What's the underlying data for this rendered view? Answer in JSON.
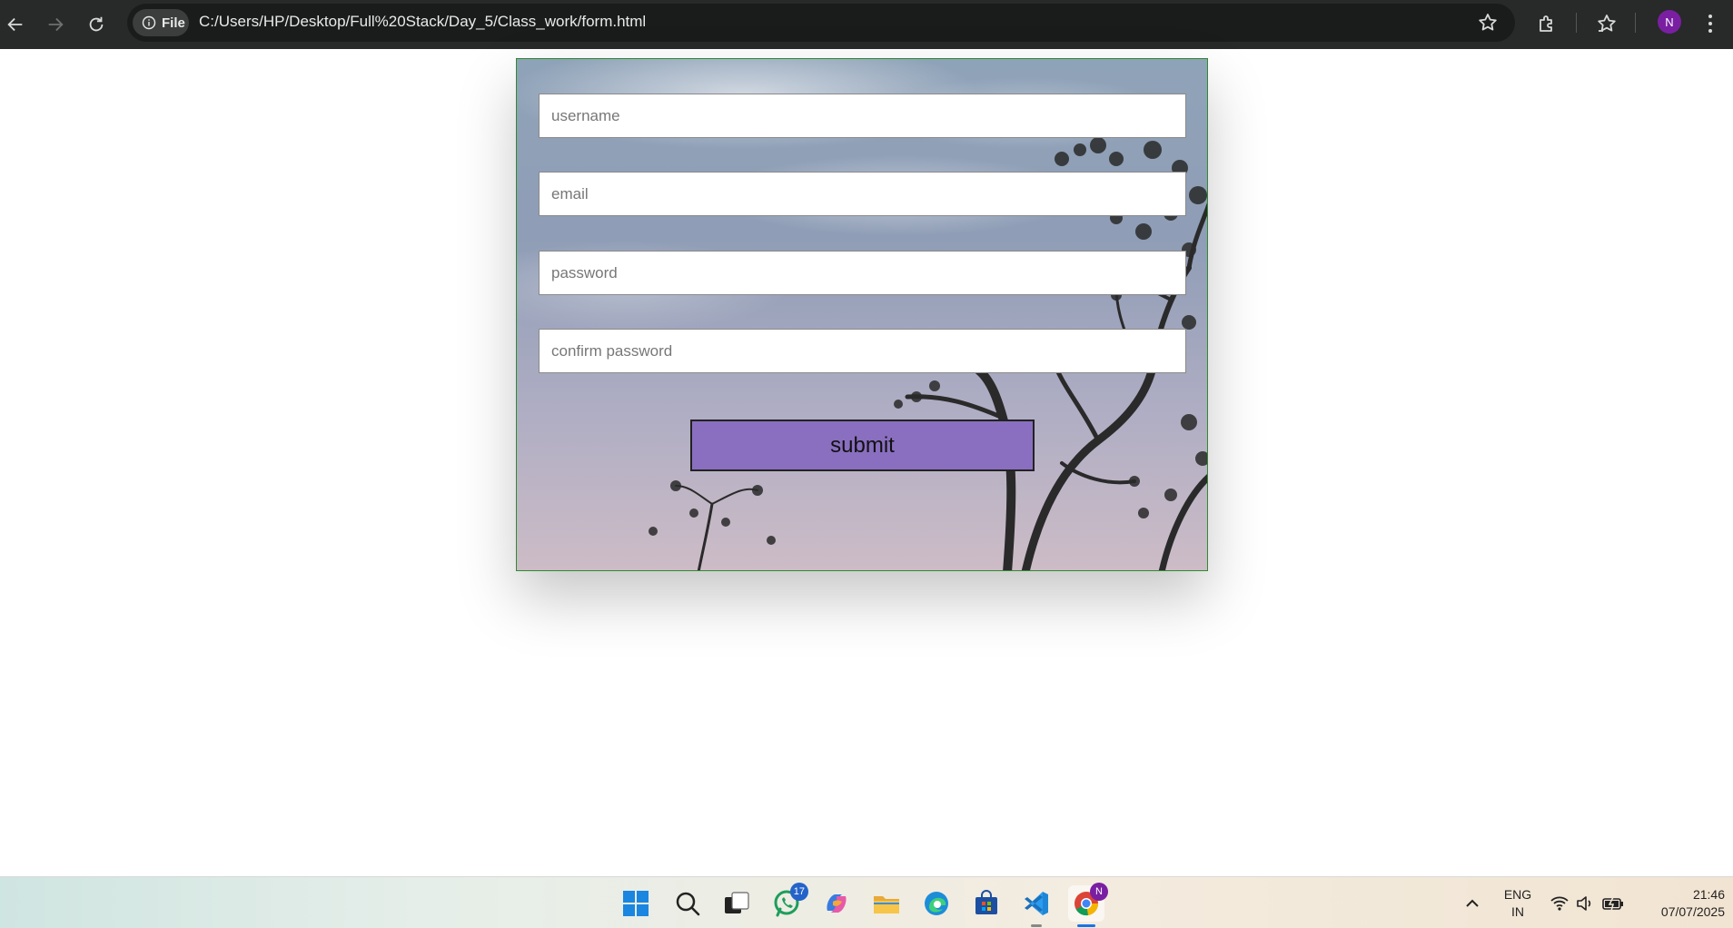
{
  "browser": {
    "scheme_chip": "File",
    "url": "C:/Users/HP/Desktop/Full%20Stack/Day_5/Class_work/form.html",
    "profile_initial": "N"
  },
  "form": {
    "username_placeholder": "username",
    "email_placeholder": "email",
    "password_placeholder": "password",
    "confirm_placeholder": "confirm password",
    "submit_label": "submit",
    "accent_color": "#8a6fc0",
    "border_color": "#2f8a2f"
  },
  "taskbar": {
    "whatsapp_badge": "17",
    "chrome_badge": "N",
    "lang_line1": "ENG",
    "lang_line2": "IN",
    "time": "21:46",
    "date": "07/07/2025"
  }
}
